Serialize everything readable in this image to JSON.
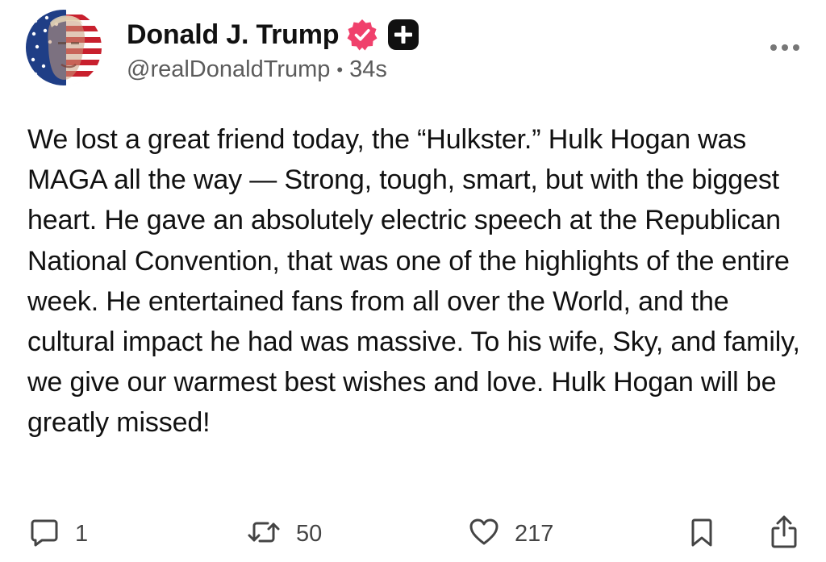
{
  "post": {
    "author": {
      "display_name": "Donald J. Trump",
      "handle": "@realDonaldTrump",
      "separator": "•",
      "time": "34s",
      "verified_color": "#f0416c",
      "badge_icon": "plus-badge-icon",
      "avatar_icon": "american-flag-portrait-avatar"
    },
    "text": "We lost a great friend today, the “Hulkster.” Hulk Hogan was MAGA all the way — Strong, tough, smart, but with the biggest heart. He gave an absolutely electric speech at the Republican National Convention, that was one of the highlights of the entire week. He entertained fans from all over the World, and the cultural impact he had was massive. To his wife, Sky, and family, we give our warmest best wishes and love. Hulk Hogan will be greatly missed!",
    "actions": {
      "reply": {
        "icon": "reply-icon",
        "count": "1"
      },
      "repost": {
        "icon": "repost-icon",
        "count": "50"
      },
      "like": {
        "icon": "heart-icon",
        "count": "217"
      },
      "bookmark": {
        "icon": "bookmark-icon"
      },
      "share": {
        "icon": "share-icon"
      }
    },
    "menu_icon": "more-options-icon"
  }
}
